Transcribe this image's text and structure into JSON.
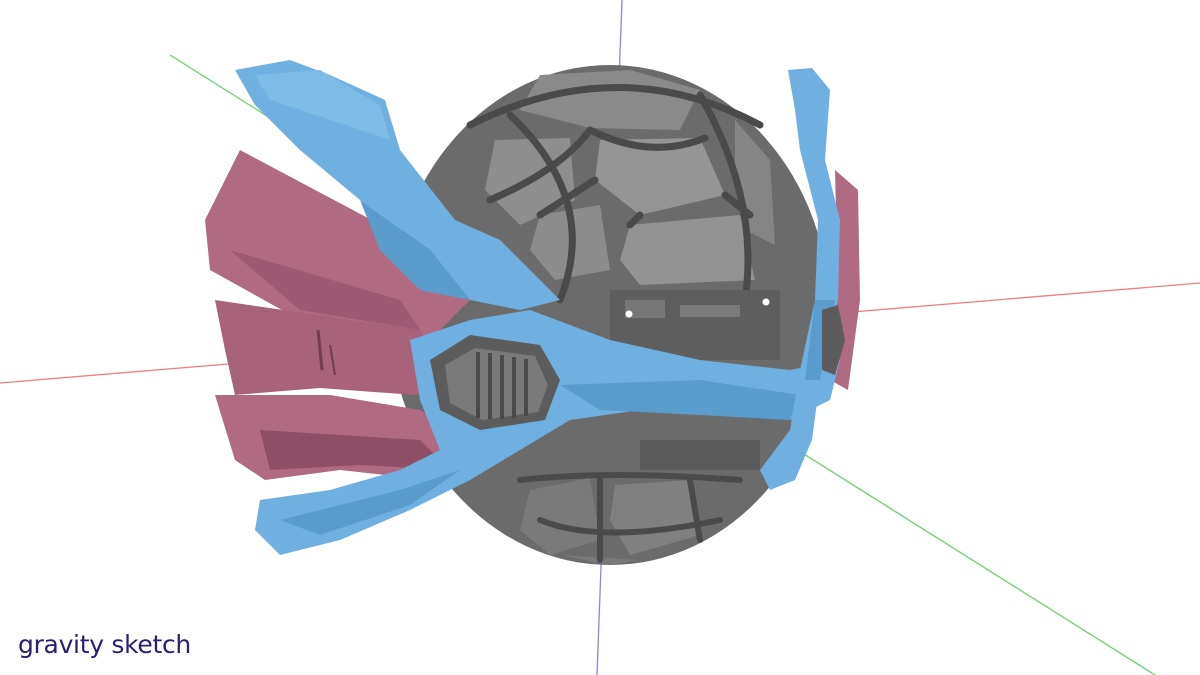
{
  "app": {
    "brand_text": "gravity sketch"
  },
  "colors": {
    "background": "#ffffff",
    "brand_text": "#2b1d75",
    "axis_x": "#f08080",
    "axis_y": "#6fcf6f",
    "axis_z": "#8a86e8",
    "shell_gray": "#6b6b6b",
    "shell_panel": "#8e8e8e",
    "frame_dark": "#4a4a4a",
    "wing_blue": "#6fb0e0",
    "wing_blue_shade": "#5a9ccc",
    "fin_rose": "#b06a82",
    "fin_rose_shade": "#8e4f66"
  },
  "viewport": {
    "model_name": "helmet-concept-model"
  }
}
